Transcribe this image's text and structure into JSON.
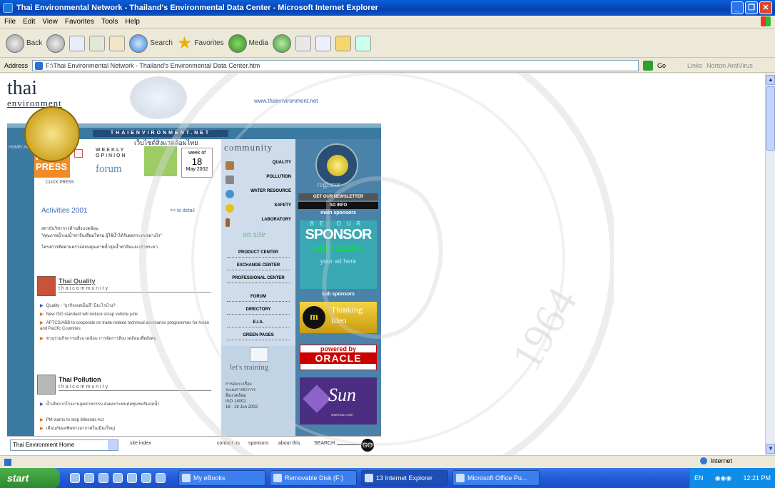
{
  "window": {
    "title": "Thai Environmental Network - Thailand's Environmental Data Center - Microsoft Internet Explorer"
  },
  "menu": [
    "File",
    "Edit",
    "View",
    "Favorites",
    "Tools",
    "Help"
  ],
  "toolbar": {
    "back": "Back",
    "search": "Search",
    "favorites": "Favorites",
    "media": "Media"
  },
  "address": {
    "label": "Address",
    "url": "F:\\Thai Environmental Network - Thailand's Environmental Data Center.htm",
    "go": "Go",
    "links": "Links",
    "norton": "Norton AntiVirus"
  },
  "site": {
    "logo_line1": "thai",
    "logo_line2": "environment",
    "url_text": "www.thaienvironment.net",
    "banner": "THAIENVIRONMENT.NET",
    "breadcrumb": "HOME/ ACCESS HIERARCHY ",
    "thai_header": "เว็บไซต์สิ่งแวดล้อมไทย",
    "from_press": "FROM PRESS",
    "click_press": "CLICK PRESS",
    "weekly_word": "WEEKLY",
    "opinion_word": "OPINION",
    "forum": "forum",
    "date_week": "week of",
    "date_day": "18",
    "date_month": "May 2002",
    "activities_title": "Activities 2001",
    "activities_link": "<< to detail",
    "activities_lines": [
      "สถาบันวิชาการด้านสิ่งแวดล้อม",
      "\"คุณภาพน้ำแม่น้ำท่าจีนเสื่อมโทรม ผู้ใช้น้ำได้รับผลกระทบอย่างไร\"",
      "โครงการติดตามตรวจสอบคุณภาพน้ำลุ่มน้ำท่าจีนและเจ้าพระยา"
    ],
    "quality": {
      "title": "Thai Quality",
      "subtitle": "thaicommunity",
      "items": [
        "Quality - \"ธุรกิจเอสเอ็มอี\" มีอะไรบ้าง?",
        "New ISO standard will reduce scrap vehicle junk",
        "APTCS/ABB to cooperate on trade-related technical assistance programmes for Asian and Pacific Countries",
        "ชวนร่วมกิจกรรมสิ่งแวดล้อม การจัดการสิ่งแวดล้อมเพื่อสังคม"
      ]
    },
    "pollution": {
      "title": "Thai Pollution",
      "subtitle": "thaicommunity",
      "items": [
        "น้ำเสียจากโรงงานอุตสาหกรรม ส่งผลกระทบต่อชุมชนริมแม่น้ำ",
        "PM warns to stop Minerals Act",
        "เตือนภัยมลพิษทางอากาศในเมืองใหญ่"
      ]
    },
    "community": {
      "header": "community",
      "items": [
        "QUALITY",
        "POLLUTION",
        "WATER RESOURCE",
        "SAFETY",
        "LABORATORY"
      ]
    },
    "onsite": {
      "header": "on site",
      "items": [
        "PRODUCT CENTER",
        "EXCHANGE CENTER",
        "PROFESSIONAL CENTER",
        "FORUM",
        "DIRECTORY",
        "E.I.A.",
        "GREEN PAGES"
      ]
    },
    "training": {
      "header": "let's training",
      "lines": [
        "การอบรมเรื่อง",
        "ระบบการจัดการ",
        "สิ่งแวดล้อม",
        "ISO 14001",
        "18 - 19 Jun 2002"
      ]
    },
    "register": "register",
    "right_bars": [
      "GET OUR NEWSLETTER",
      "AD INFO"
    ],
    "main_sponsors": "main sponsors",
    "sponsor_letters": "BE OUR",
    "sponsor_word": "SPONSOR",
    "sponsor_call": "call 7121345",
    "sponsor_ad": "your ad here",
    "sub_sponsors": "sub sponsors",
    "ideo_text": "Thinking Ideo",
    "ideo_mark": "m",
    "powered_by": "powered by",
    "oracle": "ORACLE",
    "sun": "Sun",
    "sun_url": "www.sun.com",
    "bottom": {
      "select": "Thai Environment Home",
      "site_index": "site index",
      "contact": "contact us",
      "sponsors": "sponsors",
      "about": "about this",
      "search": "SEARCH",
      "go": "GO"
    }
  },
  "status": {
    "zone": "Internet"
  },
  "taskbar": {
    "start": "start",
    "tasks": [
      "My eBooks",
      "Removable Disk (F:)",
      "13 Internet Explorer",
      "Microsoft Office Pu..."
    ],
    "tray_lang": "EN",
    "clock": "12:21 PM"
  }
}
